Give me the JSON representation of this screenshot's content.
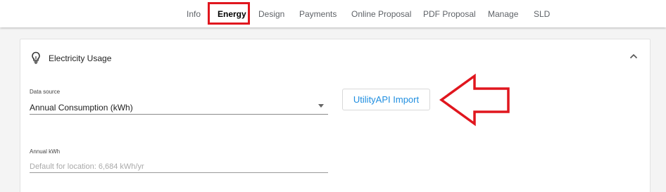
{
  "nav": {
    "tabs": [
      {
        "label": "Info"
      },
      {
        "label": "Energy"
      },
      {
        "label": "Design"
      },
      {
        "label": "Payments"
      },
      {
        "label": "Online Proposal"
      },
      {
        "label": "PDF Proposal"
      },
      {
        "label": "Manage"
      },
      {
        "label": "SLD"
      }
    ],
    "active_tab": "Energy"
  },
  "section": {
    "title": "Electricity Usage",
    "icon": "lightbulb-icon",
    "collapse_icon": "chevron-up-icon"
  },
  "data_source": {
    "label": "Data source",
    "value": "Annual Consumption (kWh)"
  },
  "import_button": {
    "label": "UtilityAPI Import"
  },
  "annual_kwh": {
    "label": "Annual kWh",
    "placeholder": "Default for location: 6,684 kWh/yr"
  },
  "colors": {
    "accent": "#1f8ee0",
    "annotation": "#e0161e"
  }
}
